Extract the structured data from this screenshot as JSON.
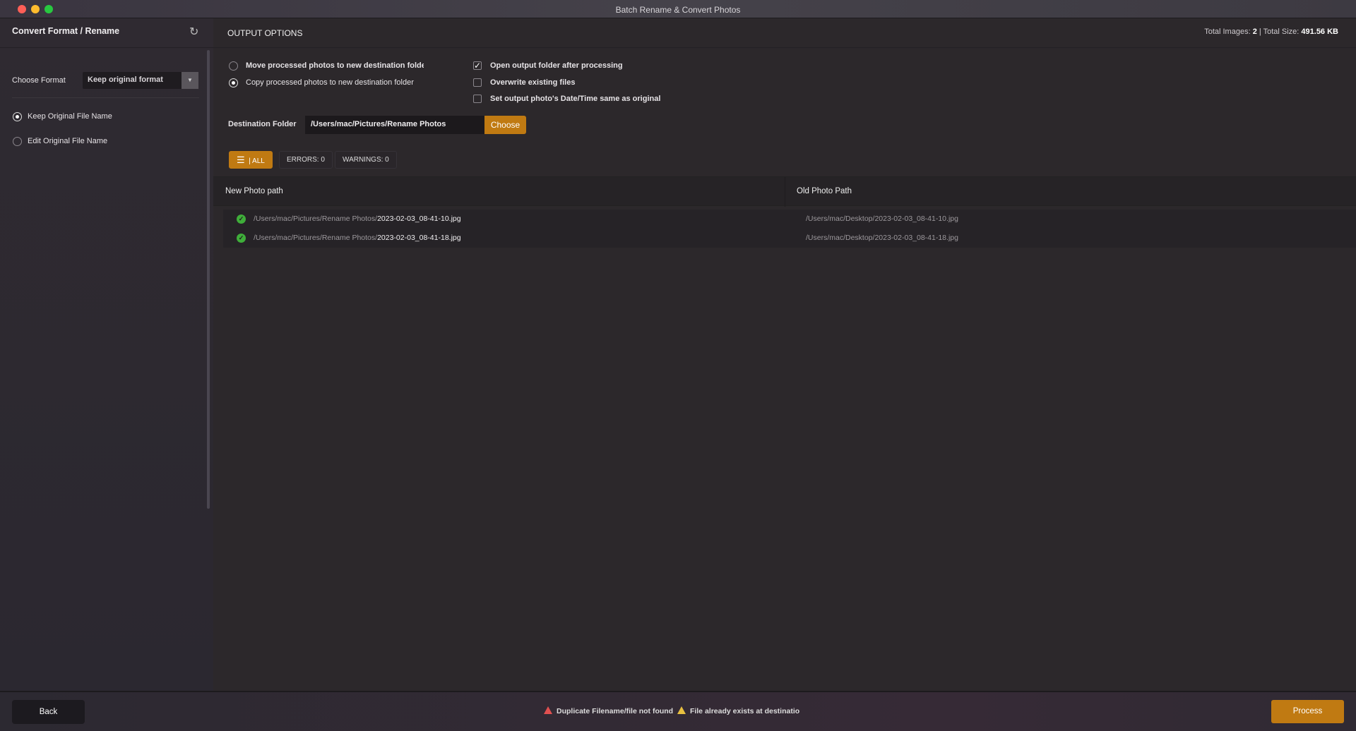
{
  "window": {
    "title": "Batch Rename & Convert Photos"
  },
  "sidebar": {
    "title": "Convert Format / Rename",
    "format_label": "Choose Format",
    "format_value": "Keep original format",
    "name_options": [
      {
        "label": "Keep Original File Name",
        "selected": true
      },
      {
        "label": "Edit Original File Name",
        "selected": false
      }
    ]
  },
  "main": {
    "section_title": "OUTPUT OPTIONS",
    "totals": {
      "images_label": "Total Images:",
      "images_value": "2",
      "sep": "|",
      "size_label": "Total Size:",
      "size_value": "491.56 KB"
    },
    "move_options": [
      {
        "label": "Move processed photos to new destination folde",
        "selected": false
      },
      {
        "label": "Copy processed photos to new destination folder",
        "selected": true
      }
    ],
    "checkboxes": [
      {
        "label": "Open output folder after processing",
        "checked": true
      },
      {
        "label": "Overwrite existing files",
        "checked": false
      },
      {
        "label": "Set output photo's Date/Time same as original",
        "checked": false
      }
    ],
    "destination": {
      "label": "Destination Folder",
      "value": "/Users/mac/Pictures/Rename Photos",
      "button": "Choose"
    },
    "filters": {
      "all": "ALL",
      "errors": "ERRORS: 0",
      "warnings": "WARNINGS: 0"
    },
    "table": {
      "headers": [
        "New Photo path",
        "Old Photo Path"
      ],
      "rows": [
        {
          "new_dir": "/Users/mac/Pictures/Rename Photos/",
          "new_file": "2023-02-03_08-41-10.jpg",
          "old": "/Users/mac/Desktop/2023-02-03_08-41-10.jpg",
          "status": "ok"
        },
        {
          "new_dir": "/Users/mac/Pictures/Rename Photos/",
          "new_file": "2023-02-03_08-41-18.jpg",
          "old": "/Users/mac/Desktop/2023-02-03_08-41-18.jpg",
          "status": "ok"
        }
      ]
    }
  },
  "footer": {
    "back": "Back",
    "process": "Process",
    "legend_error": "Duplicate Filename/file not found",
    "legend_warning": "File already exists at destinatio"
  },
  "colors": {
    "accent": "#c07a12",
    "success": "#3fae3a",
    "error": "#e05050",
    "warning": "#e8c040"
  }
}
